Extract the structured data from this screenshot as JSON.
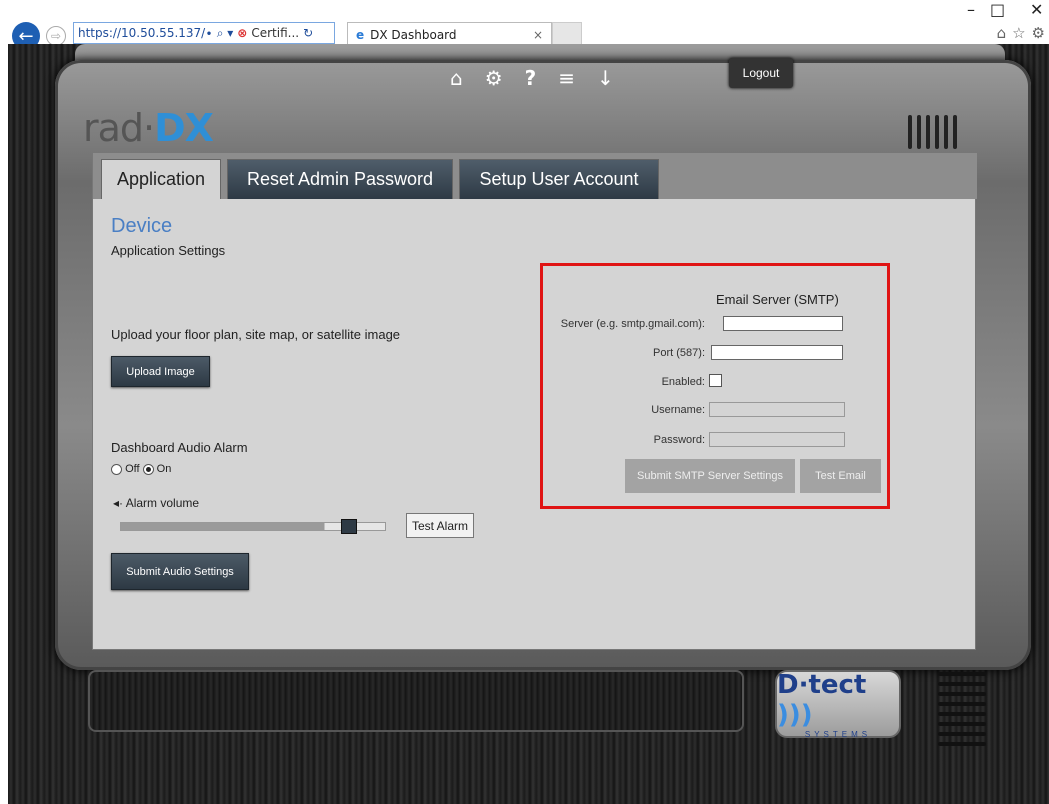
{
  "browser": {
    "url": "https://10.50.55.137/∙",
    "search_glyph": "⌕ ▾",
    "cert_text": "Certifi...",
    "cert_glyph": "⊗",
    "reload_glyph": "↻",
    "tab_title": "DX Dashboard",
    "tab_close": "×",
    "back_glyph": "←",
    "forward_glyph": "⇨",
    "minimize_glyph": "–",
    "maximize_glyph": "□",
    "close_glyph": "✕",
    "toolbar_icons": [
      "⌂",
      "☆",
      "⚙"
    ]
  },
  "header": {
    "logo_prefix": "rad·",
    "logo_suffix": "DX",
    "logout_label": "Logout",
    "top_icons": [
      "⌂",
      "⚙",
      "?",
      "≡",
      "↓"
    ]
  },
  "tabs": [
    {
      "label": "Application"
    },
    {
      "label": "Reset Admin Password"
    },
    {
      "label": "Setup User Account"
    }
  ],
  "main": {
    "title": "Device",
    "subtitle": "Application Settings",
    "upload_prompt": "Upload your floor plan, site map, or satellite image",
    "upload_button": "Upload Image",
    "audio_heading": "Dashboard Audio Alarm",
    "radio_off": "Off",
    "radio_on": "On",
    "selected_radio": "On",
    "volume_icon": "◂·",
    "volume_label": "Alarm volume",
    "volume_level_percent": 77,
    "test_alarm_button": "Test Alarm",
    "submit_audio_button": "Submit Audio Settings"
  },
  "smtp": {
    "heading": "Email Server (SMTP)",
    "server_label": "Server (e.g. smtp.gmail.com):",
    "server_value": "",
    "port_label": "Port (587):",
    "port_value": "",
    "enabled_label": "Enabled:",
    "enabled": false,
    "username_label": "Username:",
    "password_label": "Password:",
    "submit_button": "Submit SMTP Server Settings",
    "test_button": "Test Email"
  },
  "footer": {
    "brand_text": "D·tect",
    "brand_subtext": "SYSTEMS"
  },
  "colors": {
    "accent_blue": "#4a7fc4",
    "highlight_red": "#e01414",
    "button_dark": "#2e3a45"
  }
}
